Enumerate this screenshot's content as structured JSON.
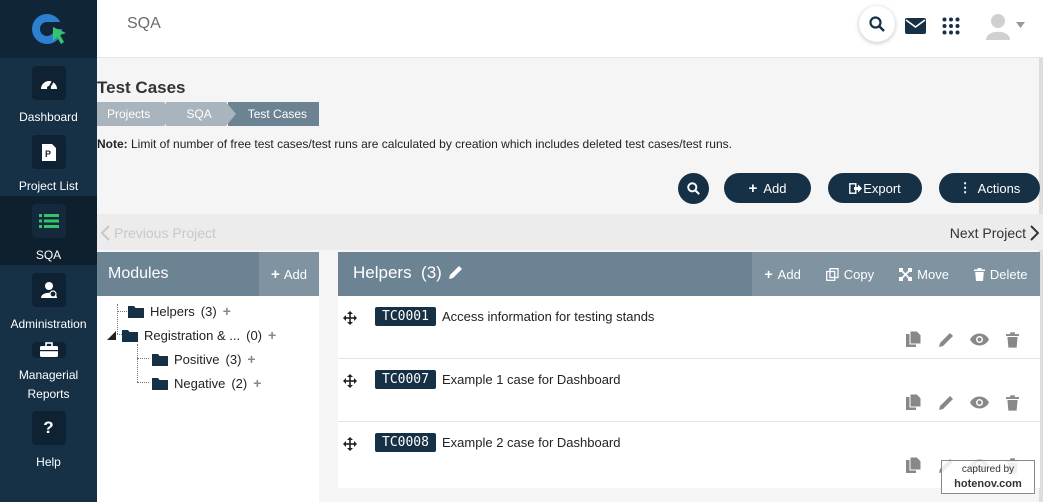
{
  "topbar": {
    "title": "SQA"
  },
  "sidebar": {
    "items": [
      {
        "label": "Dashboard",
        "icon": "dashboard-icon"
      },
      {
        "label": "Project List",
        "icon": "project-list-icon"
      },
      {
        "label": "SQA",
        "icon": "list-icon"
      },
      {
        "label": "Administration",
        "icon": "admin-icon"
      },
      {
        "label": "Managerial Reports",
        "icon": "briefcase-icon"
      },
      {
        "label": "Help",
        "icon": "help-icon"
      }
    ]
  },
  "page": {
    "title": "Test Cases",
    "breadcrumb": [
      "Projects",
      "SQA",
      "Test Cases"
    ],
    "note_label": "Note:",
    "note_text": " Limit of number of free test cases/test runs are calculated by creation which includes deleted test cases/test runs."
  },
  "toolbar": {
    "add_label": "Add",
    "export_label": "Export",
    "actions_label": "Actions"
  },
  "project_nav": {
    "prev_label": "Previous Project",
    "next_label": "Next Project"
  },
  "modules": {
    "title": "Modules",
    "add_label": "Add",
    "tree": [
      {
        "label": "Helpers",
        "count": "(3)"
      },
      {
        "label": "Registration & ...",
        "count": "(0)"
      },
      {
        "label": "Positive",
        "count": "(3)"
      },
      {
        "label": "Negative",
        "count": "(2)"
      }
    ]
  },
  "helpers": {
    "title": "Helpers",
    "count": "(3)",
    "actions": {
      "add": "Add",
      "copy": "Copy",
      "move": "Move",
      "delete": "Delete"
    },
    "cases": [
      {
        "id": "TC0001",
        "title": "Access information for testing stands"
      },
      {
        "id": "TC0007",
        "title": "Example 1 case for Dashboard"
      },
      {
        "id": "TC0008",
        "title": "Example 2 case for Dashboard"
      }
    ]
  },
  "watermark": {
    "line1": "captured by",
    "line2": "hotenov.com"
  },
  "colors": {
    "navy": "#163046",
    "slate": "#6c8393",
    "crumb": "#aab4bc"
  }
}
